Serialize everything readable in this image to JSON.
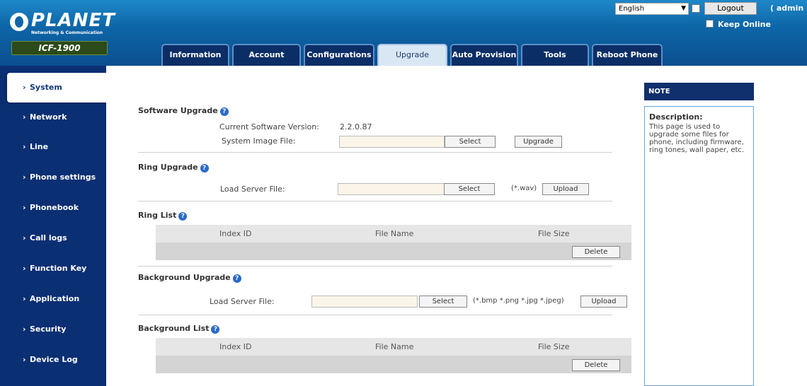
{
  "header": {
    "logo_text": "PLANET",
    "logo_sub": "Networking & Communication",
    "model": "ICF-1900",
    "language": "English",
    "logout_label": "Logout",
    "user_label": "( admin )",
    "keep_online_label": "Keep Online"
  },
  "tabs": [
    {
      "label": "Information"
    },
    {
      "label": "Account"
    },
    {
      "label": "Configurations"
    },
    {
      "label": "Upgrade"
    },
    {
      "label": "Auto Provision"
    },
    {
      "label": "Tools"
    },
    {
      "label": "Reboot Phone"
    }
  ],
  "sidebar": {
    "items": [
      {
        "label": "System"
      },
      {
        "label": "Network"
      },
      {
        "label": "Line"
      },
      {
        "label": "Phone settings"
      },
      {
        "label": "Phonebook"
      },
      {
        "label": "Call logs"
      },
      {
        "label": "Function Key"
      },
      {
        "label": "Application"
      },
      {
        "label": "Security"
      },
      {
        "label": "Device Log"
      }
    ]
  },
  "software_upgrade": {
    "title": "Software Upgrade",
    "current_version_label": "Current Software Version:",
    "current_version": "2.2.0.87",
    "image_file_label": "System Image File:",
    "select_label": "Select",
    "upgrade_label": "Upgrade"
  },
  "ring_upgrade": {
    "title": "Ring Upgrade",
    "load_label": "Load Server File:",
    "select_label": "Select",
    "hint": "(*.wav)",
    "upload_label": "Upload"
  },
  "ring_list": {
    "title": "Ring List",
    "columns": [
      "Index ID",
      "File Name",
      "File Size"
    ],
    "delete_label": "Delete"
  },
  "background_upgrade": {
    "title": "Background Upgrade",
    "load_label": "Load Server File:",
    "select_label": "Select",
    "hint": "(*.bmp *.png *.jpg *.jpeg)",
    "upload_label": "Upload"
  },
  "background_list": {
    "title": "Background List",
    "columns": [
      "Index ID",
      "File Name",
      "File Size"
    ],
    "delete_label": "Delete"
  },
  "note": {
    "header": "NOTE",
    "title": "Description:",
    "text": "This page is used to upgrade some files for phone, including firmware, ring tones, wall paper, etc."
  }
}
